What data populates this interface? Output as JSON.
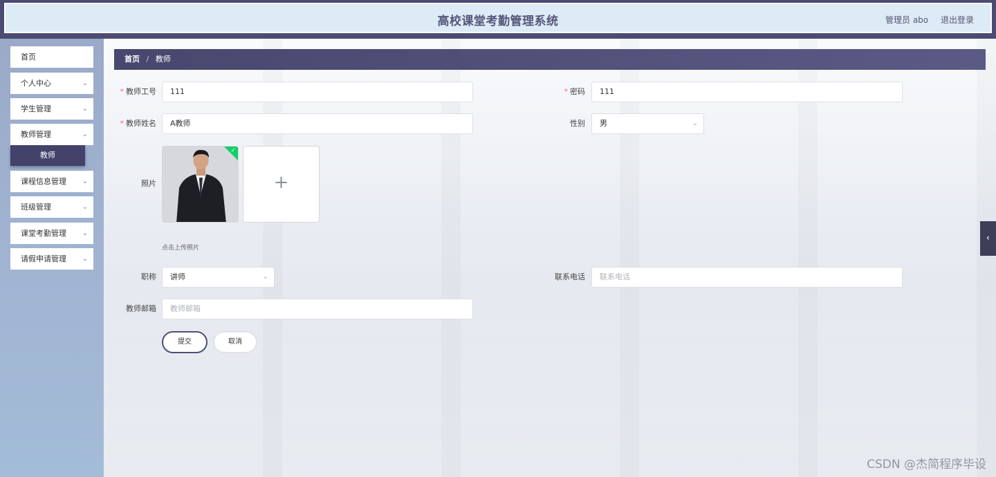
{
  "header": {
    "title": "高校课堂考勤管理系统",
    "user_label": "管理员 abo",
    "logout_label": "退出登录"
  },
  "sidebar": {
    "items": [
      {
        "label": "首页",
        "expandable": false
      },
      {
        "label": "个人中心",
        "expandable": true
      },
      {
        "label": "学生管理",
        "expandable": true
      },
      {
        "label": "教师管理",
        "expandable": true
      },
      {
        "label": "课程信息管理",
        "expandable": true
      },
      {
        "label": "班级管理",
        "expandable": true
      },
      {
        "label": "课堂考勤管理",
        "expandable": true
      },
      {
        "label": "请假申请管理",
        "expandable": true
      }
    ],
    "active_subitem": "教师"
  },
  "breadcrumb": {
    "home": "首页",
    "separator": "/",
    "current": "教师"
  },
  "form": {
    "teacher_id": {
      "label": "教师工号",
      "value": "111",
      "required": true
    },
    "password": {
      "label": "密码",
      "value": "111",
      "required": true
    },
    "teacher_name": {
      "label": "教师姓名",
      "value": "A教师",
      "required": true
    },
    "gender": {
      "label": "性别",
      "value": "男"
    },
    "photo": {
      "label": "照片",
      "hint": "点击上传照片",
      "add_symbol": "+"
    },
    "title": {
      "label": "职称",
      "value": "讲师"
    },
    "phone": {
      "label": "联系电话",
      "placeholder": "联系电话"
    },
    "email": {
      "label": "教师邮箱",
      "placeholder": "教师邮箱"
    },
    "required_mark": "*",
    "submit_label": "提交",
    "cancel_label": "取消"
  },
  "side_toggle": {
    "icon": "chevron-left-icon",
    "glyph": "‹"
  },
  "watermark": "CSDN @杰简程序毕设",
  "colors": {
    "header_bg": "#4b4b73",
    "accent": "#43426a",
    "required": "#f56c6c",
    "success": "#13ce66"
  }
}
